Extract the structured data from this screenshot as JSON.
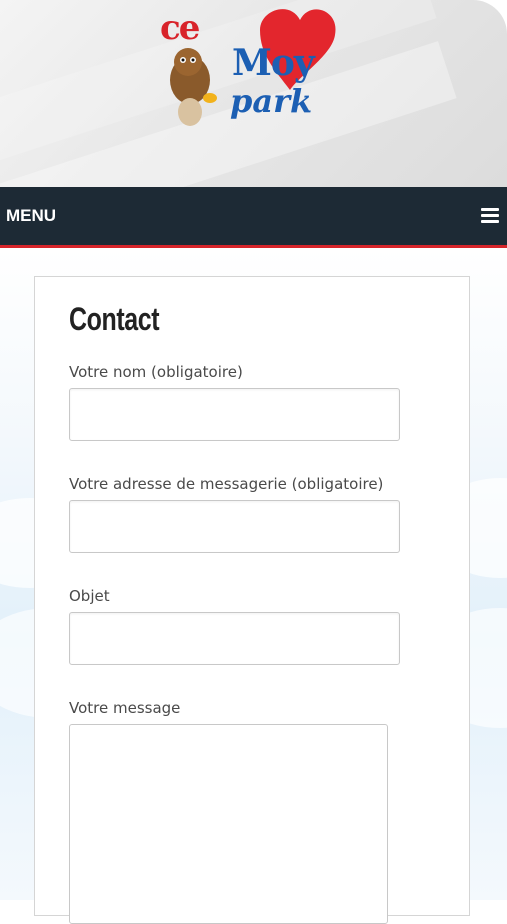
{
  "header": {
    "logo": {
      "text_ce": "ce",
      "text_moy": "Moy",
      "text_park": "park"
    }
  },
  "nav": {
    "menu_label": "MENU",
    "menu_icon": "hamburger-icon"
  },
  "page": {
    "title": "Contact"
  },
  "form": {
    "name_label": "Votre nom (obligatoire)",
    "name_value": "",
    "email_label": "Votre adresse de messagerie (obligatoire)",
    "email_value": "",
    "subject_label": "Objet",
    "subject_value": "",
    "message_label": "Votre message",
    "message_value": ""
  },
  "colors": {
    "navbar": "#1d2a35",
    "navbar_accent": "#d6242a",
    "logo_red": "#d8232a",
    "logo_blue": "#1c5fb3"
  }
}
